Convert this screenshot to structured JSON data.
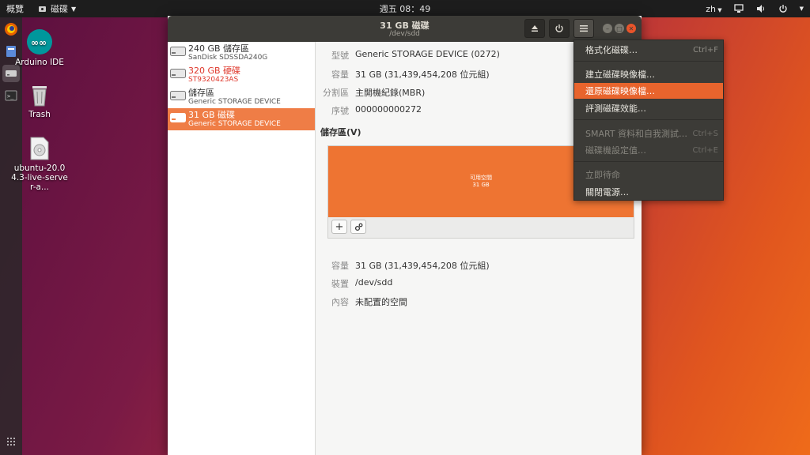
{
  "topbar": {
    "activities": "概覽",
    "app_menu": "磁碟",
    "clock": "週五 08：49",
    "input_method": "zh"
  },
  "desktop": {
    "icons": [
      {
        "label": "Arduino IDE"
      },
      {
        "label": "Trash"
      },
      {
        "label": "ubuntu-20.04.3-live-server-a..."
      }
    ]
  },
  "window": {
    "title": "31 GB 磁碟",
    "subtitle": "/dev/sdd"
  },
  "drives": [
    {
      "name": "240 GB 儲存區",
      "model": "SanDisk SDSSDA240G"
    },
    {
      "name": "320 GB 硬碟",
      "model": "ST9320423AS"
    },
    {
      "name": "儲存區",
      "model": "Generic STORAGE DEVICE"
    },
    {
      "name": "31 GB 磁碟",
      "model": "Generic STORAGE DEVICE"
    }
  ],
  "details": {
    "model_label": "型號",
    "model_value": "Generic STORAGE DEVICE (0272)",
    "size_label": "容量",
    "size_value": "31 GB (31,439,454,208 位元組)",
    "partitioning_label": "分割區",
    "partitioning_value": "主開機紀錄(MBR)",
    "serial_label": "序號",
    "serial_value": "000000000272"
  },
  "volumes": {
    "section_title": "儲存區(V)",
    "block_label": "可用空間",
    "block_size": "31 GB",
    "add_icon": "plus-icon",
    "settings_icon": "gears-icon"
  },
  "selected_volume": {
    "size_label": "容量",
    "size_value": "31 GB (31,439,454,208 位元組)",
    "device_label": "裝置",
    "device_value": "/dev/sdd",
    "contents_label": "內容",
    "contents_value": "未配置的空間"
  },
  "menu": {
    "items": [
      {
        "label": "格式化磁碟…",
        "accel": "Ctrl+F"
      },
      {
        "label": "建立磁碟映像檔…",
        "accel": ""
      },
      {
        "label": "還原磁碟映像檔…",
        "accel": ""
      },
      {
        "label": "評測磁碟效能…",
        "accel": ""
      },
      {
        "label": "SMART 資料和自我測試…",
        "accel": "Ctrl+S"
      },
      {
        "label": "磁碟機設定值…",
        "accel": "Ctrl+E"
      },
      {
        "label": "立即待命",
        "accel": ""
      },
      {
        "label": "關閉電源…",
        "accel": ""
      }
    ]
  },
  "colors": {
    "accent": "#ef7d46",
    "menu_highlight": "#e8642d",
    "error_red": "#df382c",
    "header": "#3c3b37"
  }
}
